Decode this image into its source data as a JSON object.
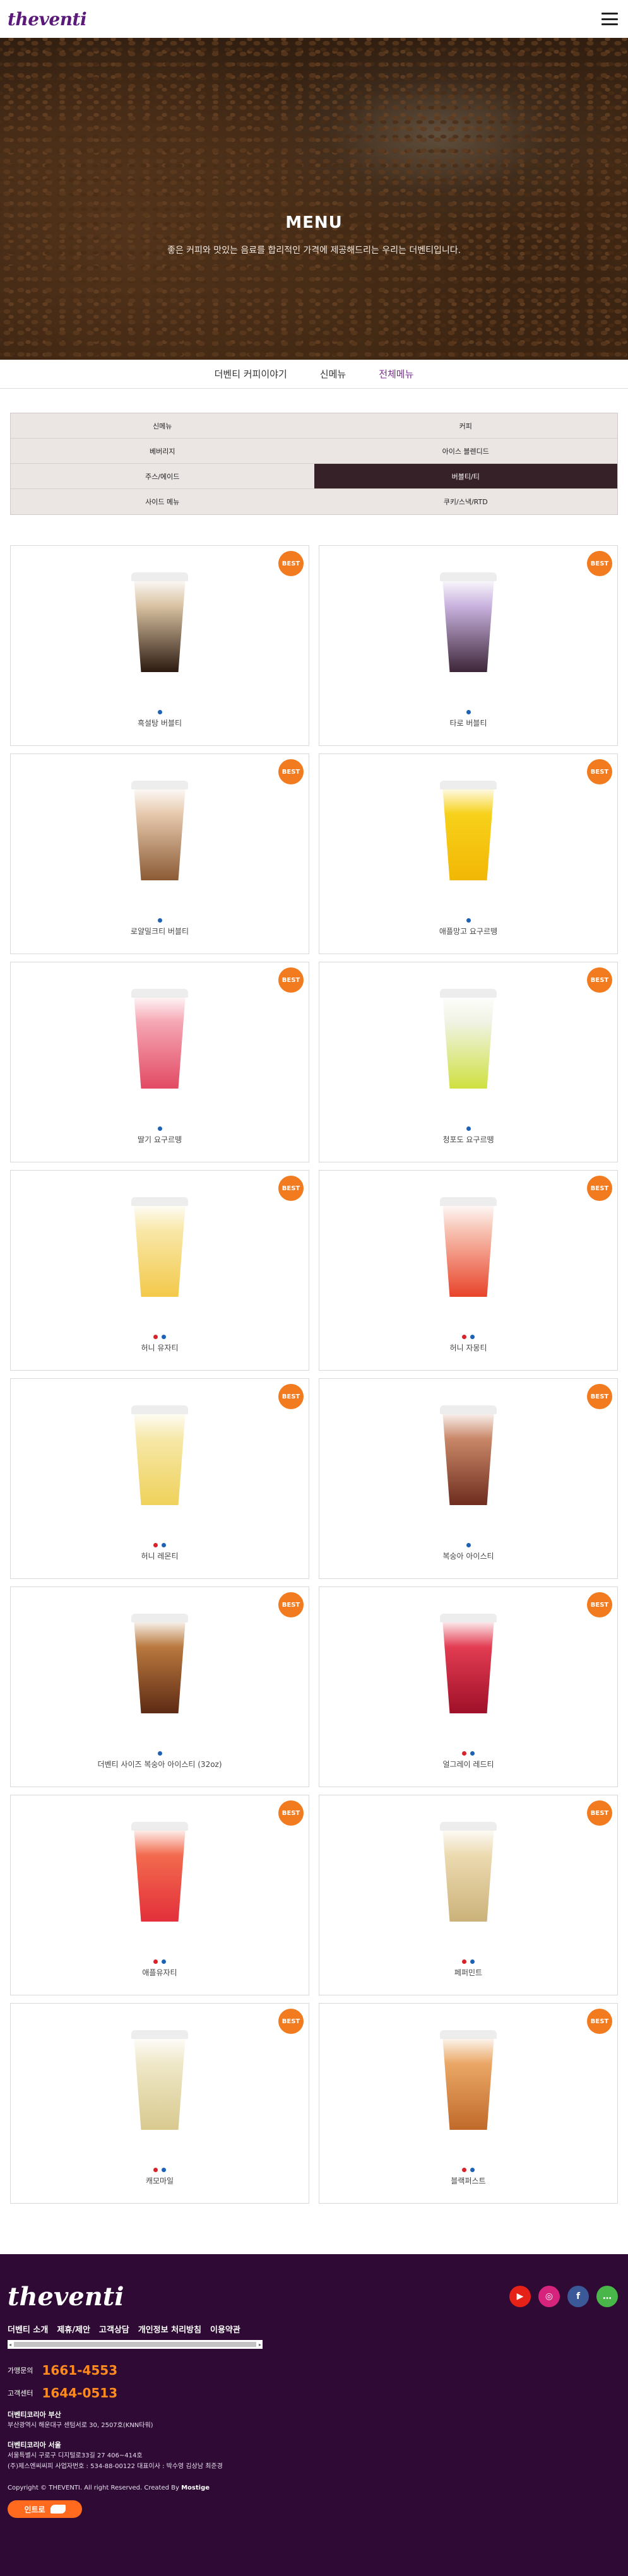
{
  "header": {
    "logo": "theventi",
    "menu_icon": "hamburger-icon"
  },
  "hero": {
    "title": "MENU",
    "subtitle": "좋은 커피와 맛있는 음료를 합리적인 가격에 제공해드리는 우리는 더벤티입니다."
  },
  "subnav": {
    "items": [
      "더벤티 커피이야기",
      "신메뉴",
      "전체메뉴"
    ],
    "active": "전체메뉴"
  },
  "categories": [
    {
      "label": "신메뉴",
      "active": false
    },
    {
      "label": "커피",
      "active": false
    },
    {
      "label": "베버리지",
      "active": false
    },
    {
      "label": "아이스 블렌디드",
      "active": false
    },
    {
      "label": "주스/에이드",
      "active": false
    },
    {
      "label": "버블티/티",
      "active": true
    },
    {
      "label": "사이드 메뉴",
      "active": false
    },
    {
      "label": "쿠키/스낵/RTD",
      "active": false
    }
  ],
  "badge_label": "BEST",
  "products": [
    {
      "name": "흑설탕 버블티",
      "dots": [
        "blue"
      ],
      "cup_color": "#d9c2a2",
      "cup_bottom": "#2c1a10"
    },
    {
      "name": "타로 버블티",
      "dots": [
        "blue"
      ],
      "cup_color": "#c9b3df",
      "cup_bottom": "#3d2638"
    },
    {
      "name": "로얄밀크티 버블티",
      "dots": [
        "blue"
      ],
      "cup_color": "#e6c9ad",
      "cup_bottom": "#8b5a34"
    },
    {
      "name": "애플망고 요구르뗑",
      "dots": [
        "blue"
      ],
      "cup_color": "#f7d11a",
      "cup_bottom": "#f2b705"
    },
    {
      "name": "딸기 요구르뗑",
      "dots": [
        "blue"
      ],
      "cup_color": "#f5a6b3",
      "cup_bottom": "#e24a63"
    },
    {
      "name": "청포도 요구르뗑",
      "dots": [
        "blue"
      ],
      "cup_color": "#f0f3e4",
      "cup_bottom": "#cfe040"
    },
    {
      "name": "허니 유자티",
      "dots": [
        "red",
        "blue"
      ],
      "cup_color": "#f8e7a8",
      "cup_bottom": "#f3c94a"
    },
    {
      "name": "허니 자몽티",
      "dots": [
        "red",
        "blue"
      ],
      "cup_color": "#f7c2b2",
      "cup_bottom": "#e8442a"
    },
    {
      "name": "허니 레몬티",
      "dots": [
        "red",
        "blue"
      ],
      "cup_color": "#f6e8a8",
      "cup_bottom": "#efd15a"
    },
    {
      "name": "복숭아 아이스티",
      "dots": [
        "blue"
      ],
      "cup_color": "#c98768",
      "cup_bottom": "#6e2d1e"
    },
    {
      "name": "더벤티 사이즈 복숭아 아이스티 (32oz)",
      "dots": [
        "blue"
      ],
      "cup_color": "#b9783e",
      "cup_bottom": "#5d2a14"
    },
    {
      "name": "얼그레이 레드티",
      "dots": [
        "red",
        "blue"
      ],
      "cup_color": "#e23c52",
      "cup_bottom": "#9f1029"
    },
    {
      "name": "애플유자티",
      "dots": [
        "red",
        "blue"
      ],
      "cup_color": "#f26a4d",
      "cup_bottom": "#e32f3b"
    },
    {
      "name": "페퍼민트",
      "dots": [
        "red",
        "blue"
      ],
      "cup_color": "#ecdab0",
      "cup_bottom": "#cbb27a"
    },
    {
      "name": "캐모마일",
      "dots": [
        "red",
        "blue"
      ],
      "cup_color": "#efe8c8",
      "cup_bottom": "#d8c98e"
    },
    {
      "name": "블랙퍼스트",
      "dots": [
        "red",
        "blue"
      ],
      "cup_color": "#eaa766",
      "cup_bottom": "#c06a2a"
    }
  ],
  "footer": {
    "logo": "theventi",
    "sns": [
      {
        "icon": "youtube-icon",
        "color": "#e62117",
        "glyph": "▶"
      },
      {
        "icon": "instagram-icon",
        "color": "#d6247c",
        "glyph": "◎"
      },
      {
        "icon": "facebook-icon",
        "color": "#3b5998",
        "glyph": "f"
      },
      {
        "icon": "talk-icon",
        "color": "#49b649",
        "glyph": "…"
      }
    ],
    "links": [
      "더벤티 소개",
      "제휴/제안",
      "고객상담",
      "개인정보 처리방침",
      "이용약관"
    ],
    "franchise_label": "가맹문의",
    "franchise_phone": "1661-4553",
    "customer_label": "고객센터",
    "customer_phone": "1644-0513",
    "busan_head": "더벤티코리아 부산",
    "busan_addr": "부산광역시 해운대구 센텀서로 30, 2507호(KNN타워)",
    "seoul_head": "더벤티코리아 서울",
    "seoul_addr": "서울특별시 구로구 디지털로33길 27 406~414호",
    "company": "(주)제스엔씨씨피   사업자번호 : 534-88-00122   대표이사 : 박수영 김상남 최준경",
    "copyright_prefix": "Copyright © THEVENTI. All right Reserved. Created By ",
    "copyright_brand": "Mostige",
    "intro_label": "인트로"
  }
}
